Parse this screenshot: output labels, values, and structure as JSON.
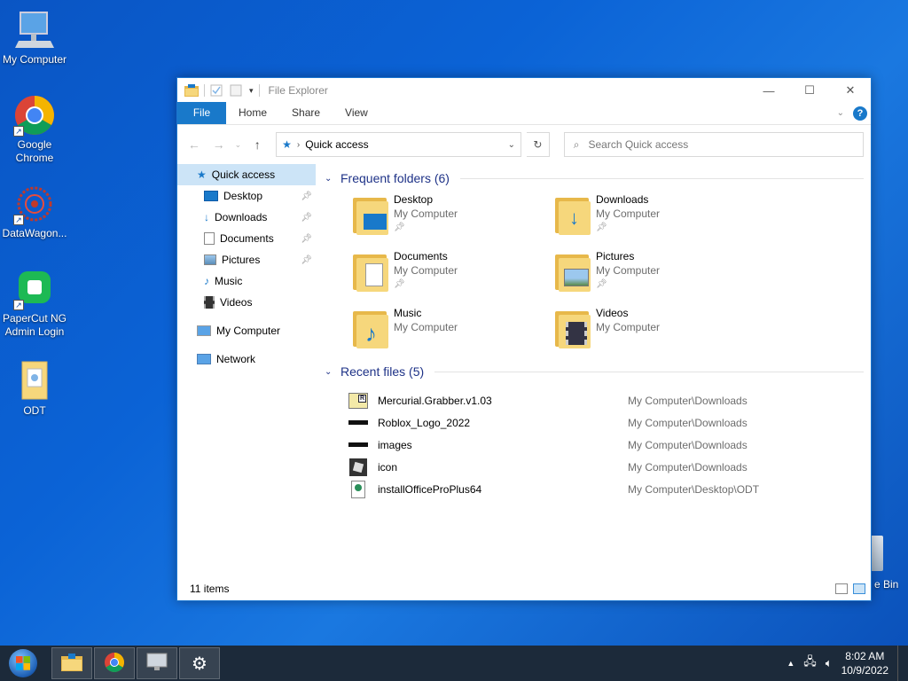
{
  "desktop": {
    "icons": [
      {
        "label": "My Computer"
      },
      {
        "label": "Google Chrome"
      },
      {
        "label": "DataWagon..."
      },
      {
        "label": "PaperCut NG Admin Login"
      },
      {
        "label": "ODT"
      }
    ],
    "recycle_bin_label": "e Bin"
  },
  "window": {
    "title": "File Explorer",
    "tabs": {
      "file": "File",
      "home": "Home",
      "share": "Share",
      "view": "View"
    },
    "help": "?",
    "address": {
      "crumb": "Quick access"
    },
    "search_placeholder": "Search Quick access",
    "nav": {
      "quick_access": "Quick access",
      "desktop": "Desktop",
      "downloads": "Downloads",
      "documents": "Documents",
      "pictures": "Pictures",
      "music": "Music",
      "videos": "Videos",
      "my_computer": "My Computer",
      "network": "Network"
    },
    "frequent_header": "Frequent folders (6)",
    "frequent": [
      {
        "name": "Desktop",
        "location": "My Computer"
      },
      {
        "name": "Downloads",
        "location": "My Computer"
      },
      {
        "name": "Documents",
        "location": "My Computer"
      },
      {
        "name": "Pictures",
        "location": "My Computer"
      },
      {
        "name": "Music",
        "location": "My Computer"
      },
      {
        "name": "Videos",
        "location": "My Computer"
      }
    ],
    "recent_header": "Recent files (5)",
    "recent": [
      {
        "name": "Mercurial.Grabber.v1.03",
        "path": "My Computer\\Downloads"
      },
      {
        "name": "Roblox_Logo_2022",
        "path": "My Computer\\Downloads"
      },
      {
        "name": "images",
        "path": "My Computer\\Downloads"
      },
      {
        "name": "icon",
        "path": "My Computer\\Downloads"
      },
      {
        "name": "installOfficeProPlus64",
        "path": "My Computer\\Desktop\\ODT"
      }
    ],
    "status": "11 items"
  },
  "taskbar": {
    "time": "8:02 AM",
    "date": "10/9/2022"
  },
  "colors": {
    "accent": "#1979ca",
    "selection": "#cce4f7",
    "group_header": "#1e3287",
    "taskbar": "#1c2a3a"
  }
}
